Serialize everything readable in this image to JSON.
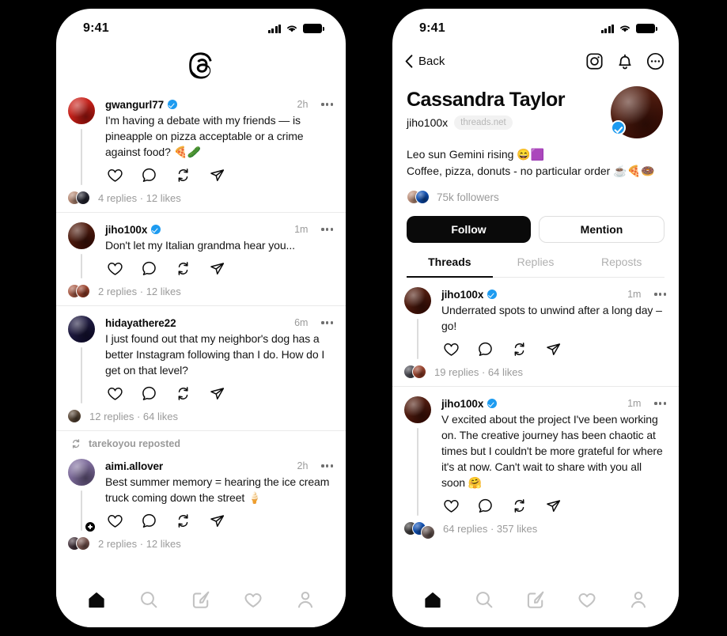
{
  "app": {
    "name": "Threads",
    "logo_icon": "threads-logo-icon"
  },
  "status_bar": {
    "time": "9:41",
    "signal_icon": "cellular-signal-icon",
    "wifi_icon": "wifi-icon",
    "battery_icon": "battery-full-icon"
  },
  "left_phone": {
    "screen": "home-feed",
    "feed": [
      {
        "username": "gwangurl77",
        "verified": true,
        "timestamp": "2h",
        "text": "I'm having a debate with my friends — is pineapple on pizza acceptable or a crime against food? 🍕🥒",
        "replies": "4 replies",
        "separator": "·",
        "likes": "12 likes",
        "avatar_color": "#d2312a",
        "facepile": [
          "#c49a86",
          "#3b3b46"
        ],
        "repost_label": null,
        "plus_badge": false
      },
      {
        "username": "jiho100x",
        "verified": true,
        "timestamp": "1m",
        "text": "Don't let my Italian grandma hear you...",
        "replies": "2 replies",
        "separator": "·",
        "likes": "12 likes",
        "avatar_color": "#5d2b1c",
        "facepile": [
          "#b9705c",
          "#a8543f"
        ],
        "repost_label": null,
        "plus_badge": false
      },
      {
        "username": "hidayathere22",
        "verified": false,
        "timestamp": "6m",
        "text": "I just found out that my neighbor's dog has a better Instagram following than I do. How do I get on that level?",
        "replies": "12 replies",
        "separator": "·",
        "likes": "64 likes",
        "avatar_color": "#2e2a4f",
        "facepile": [
          "#6b5a4a"
        ],
        "repost_label": null,
        "plus_badge": false
      },
      {
        "username": "aimi.allover",
        "verified": false,
        "timestamp": "2h",
        "text": "Best summer memory = hearing the ice cream truck coming down the street 🍦",
        "replies": "2 replies",
        "separator": "·",
        "likes": "12 likes",
        "avatar_color": "#8b7aa8",
        "facepile": [
          "#5a4a52",
          "#8c6a64"
        ],
        "repost_label": "tarekoyou reposted",
        "plus_badge": true
      }
    ],
    "post_actions": [
      "like-icon",
      "reply-icon",
      "repost-icon",
      "share-icon"
    ],
    "tab_bar": [
      "home-icon",
      "search-icon",
      "compose-icon",
      "activity-icon",
      "profile-icon"
    ],
    "active_tab": "home-icon"
  },
  "right_phone": {
    "screen": "profile",
    "top_bar": {
      "back_label": "Back",
      "back_icon": "chevron-left-icon",
      "instagram_icon": "instagram-icon",
      "bell_icon": "bell-icon",
      "more_icon": "more-circle-icon"
    },
    "profile": {
      "display_name": "Cassandra Taylor",
      "handle": "jiho100x",
      "domain_chip": "threads.net",
      "verified": true,
      "avatar_color": "#5d2b1c",
      "bio_line_1": "Leo sun Gemini rising 😄🟪",
      "bio_line_2": "Coffee, pizza, donuts - no particular order ☕🍕🍩",
      "followers": "75k followers",
      "follower_facepile": [
        "#caa08c",
        "#1f5fbf"
      ],
      "follow_button": "Follow",
      "mention_button": "Mention"
    },
    "tabs": [
      {
        "label": "Threads",
        "active": true
      },
      {
        "label": "Replies",
        "active": false
      },
      {
        "label": "Reposts",
        "active": false
      }
    ],
    "feed": [
      {
        "username": "jiho100x",
        "verified": true,
        "timestamp": "1m",
        "text": "Underrated spots to unwind after a long day – go!",
        "replies": "19 replies",
        "separator": "·",
        "likes": "64 likes",
        "avatar_color": "#5d2b1c",
        "facepile": [
          "#5e5e66",
          "#a8543f"
        ]
      },
      {
        "username": "jiho100x",
        "verified": true,
        "timestamp": "1m",
        "text": "V excited about the project I've been working on. The creative journey has been chaotic at times but I couldn't be more grateful for where it's at now. Can't wait to share with you all soon 🤗",
        "replies": "64 replies",
        "separator": "·",
        "likes": "357 likes",
        "avatar_color": "#5d2b1c",
        "facepile": [
          "#52504f",
          "#1f5fbf",
          "#7a6a66"
        ]
      }
    ],
    "post_actions": [
      "like-icon",
      "reply-icon",
      "repost-icon",
      "share-icon"
    ],
    "tab_bar": [
      "home-icon",
      "search-icon",
      "compose-icon",
      "activity-icon",
      "profile-icon"
    ],
    "active_tab": "home-icon"
  },
  "colors": {
    "background": "#000000",
    "surface": "#ffffff",
    "text": "#0a0a0a",
    "muted": "#9a9a9a",
    "verified_blue": "#1d9bf0",
    "divider": "#eaeaea"
  }
}
